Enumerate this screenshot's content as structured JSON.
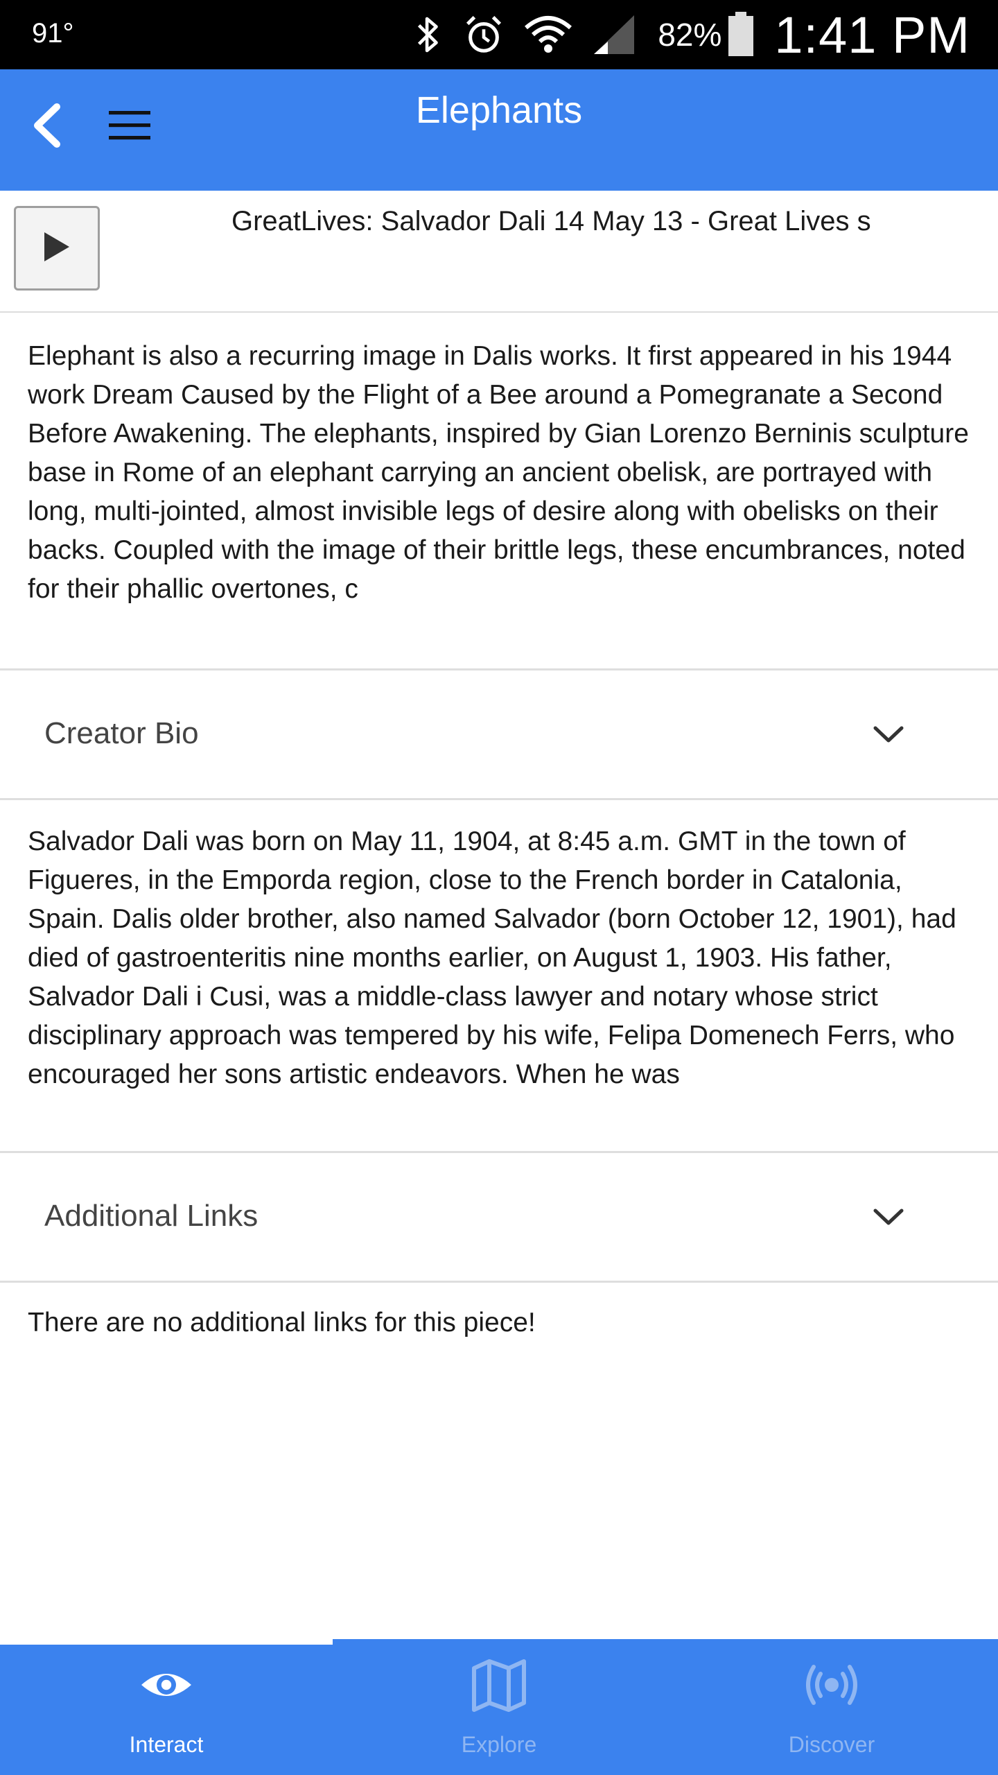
{
  "status_bar": {
    "temperature": "91°",
    "battery_percent": "82%",
    "time": "1:41 PM"
  },
  "header": {
    "title": "Elephants",
    "back_icon": "chevron-left-icon",
    "menu_icon": "hamburger-menu-icon"
  },
  "audio": {
    "title": "GreatLives: Salvador Dali 14 May 13 - Great Lives s",
    "play_icon": "play-icon"
  },
  "description": "Elephant is also a recurring image in Dalis works. It first appeared in his 1944 work Dream Caused by the Flight of a Bee around a Pomegranate a Second Before Awakening. The elephants, inspired by Gian Lorenzo Berninis sculpture base in Rome of an elephant carrying an ancient obelisk, are portrayed with long, multi-jointed, almost invisible legs of desire along with obelisks on their backs. Coupled with the image of their brittle legs, these encumbrances, noted for their phallic overtones, c",
  "creator_bio": {
    "label": "Creator Bio",
    "text": "Salvador Dali was born on May 11, 1904, at 8:45 a.m. GMT in the town of Figueres, in the Emporda region, close to the French border in Catalonia, Spain. Dalis older brother, also named Salvador (born October 12, 1901), had died of gastroenteritis nine months earlier, on August 1, 1903. His father, Salvador Dali i Cusi, was a middle-class lawyer and notary whose strict disciplinary approach was tempered by his wife, Felipa Domenech Ferrs, who encouraged her sons artistic endeavors. When he was"
  },
  "additional_links": {
    "label": "Additional Links",
    "text": "There are no additional links for this piece!"
  },
  "bottom_nav": {
    "items": [
      {
        "label": "Interact",
        "icon": "eye-icon",
        "active": true
      },
      {
        "label": "Explore",
        "icon": "map-icon",
        "active": false
      },
      {
        "label": "Discover",
        "icon": "broadcast-icon",
        "active": false
      }
    ]
  },
  "colors": {
    "primary": "#3b82ee",
    "inactive_nav": "#8fb6f2",
    "divider": "#dedede"
  }
}
